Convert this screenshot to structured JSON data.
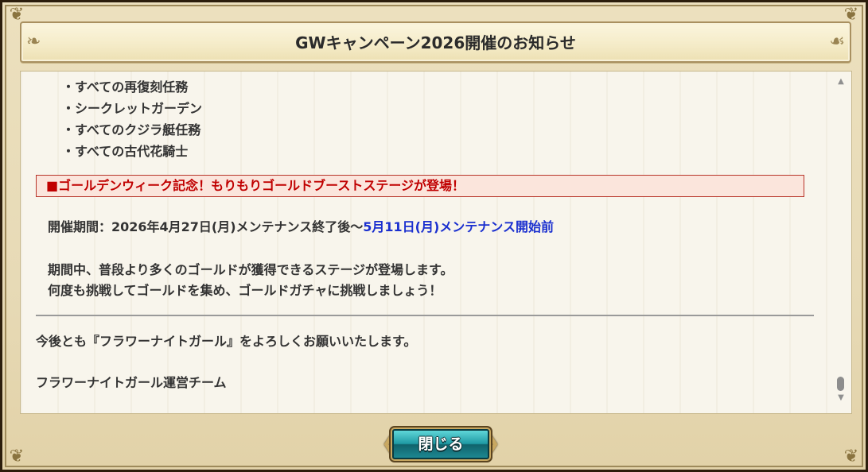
{
  "dialog": {
    "title": "GWキャンペーン2026開催のお知らせ",
    "close_label": "閉じる"
  },
  "content": {
    "bullets": [
      "・すべての再復刻任務",
      "・シークレットガーデン",
      "・すべてのクジラ艇任務",
      "・すべての古代花騎士"
    ],
    "banner": "■ゴールデンウィーク記念！もりもりゴールドブーストステージが登場！",
    "period_label": "開催期間：2026年4月27日(月)メンテナンス終了後〜",
    "period_end": "5月11日(月)メンテナンス開始前",
    "description": [
      "期間中、普段より多くのゴールドが獲得できるステージが登場します。",
      "何度も挑戦してゴールドを集め、ゴールドガチャに挑戦しましょう！"
    ],
    "closing": "今後とも『フラワーナイトガール』をよろしくお願いいたします。",
    "signature": "フラワーナイトガール運営チーム"
  },
  "colors": {
    "banner_text": "#c00000",
    "banner_bg": "#fbe5dc",
    "highlight_blue": "#1a2fcf",
    "button_teal": "#1f9aa4"
  },
  "icons": {
    "scroll_up": "triangle-up",
    "scroll_down": "triangle-down",
    "ornament": "scroll-flourish"
  }
}
